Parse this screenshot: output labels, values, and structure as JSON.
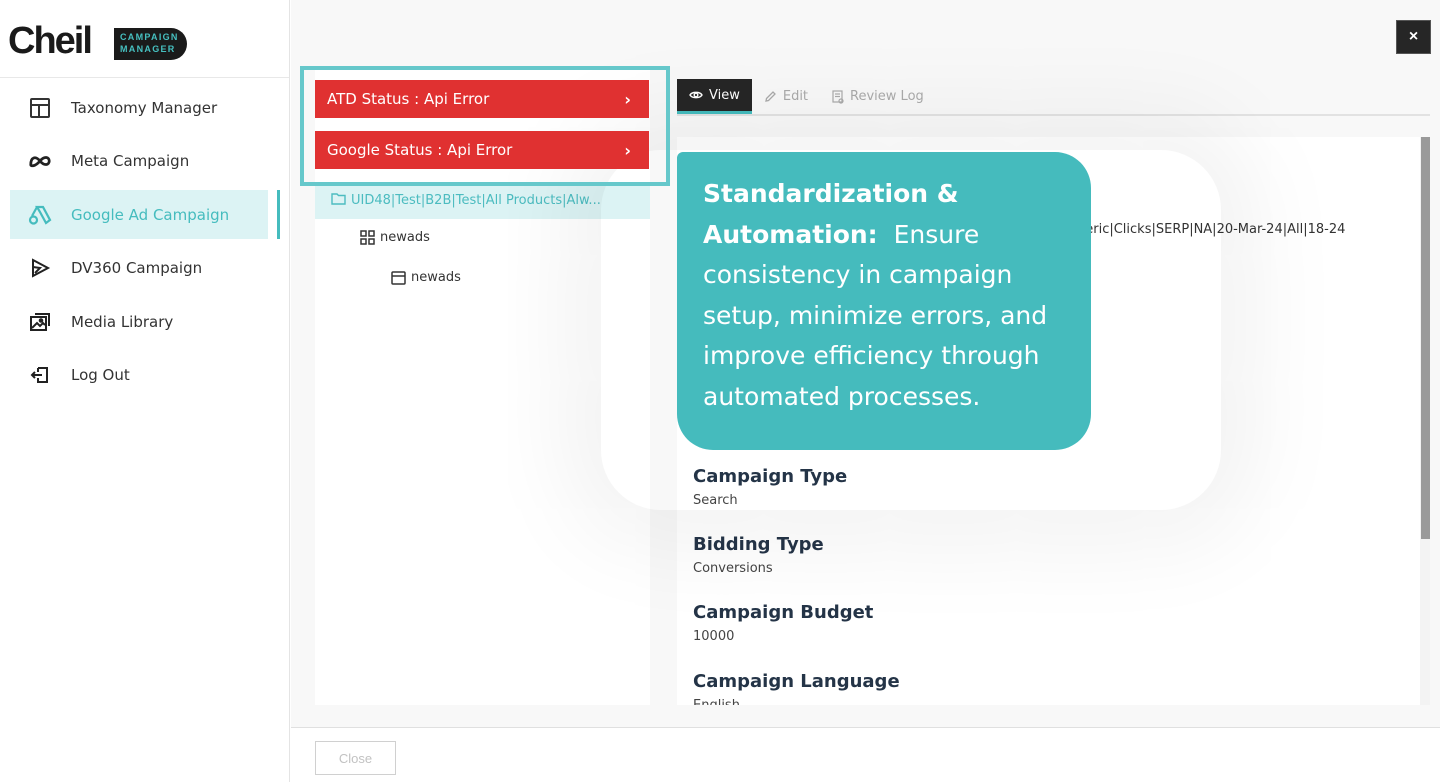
{
  "brand": {
    "name": "Cheil",
    "badge_line1": "CAMPAIGN",
    "badge_line2": "MANAGER"
  },
  "sidebar": {
    "items": [
      {
        "label": "Taxonomy Manager",
        "icon": "layout-icon",
        "active": false
      },
      {
        "label": "Meta Campaign",
        "icon": "meta-icon",
        "active": false
      },
      {
        "label": "Google Ad Campaign",
        "icon": "google-ads-icon",
        "active": true
      },
      {
        "label": "DV360 Campaign",
        "icon": "dv360-icon",
        "active": false
      },
      {
        "label": "Media Library",
        "icon": "media-library-icon",
        "active": false
      },
      {
        "label": "Log Out",
        "icon": "logout-icon",
        "active": false
      }
    ]
  },
  "modal": {
    "close_icon": "×",
    "status": {
      "atd": "ATD Status : Api Error",
      "google": "Google Status : Api Error",
      "chevron": "›",
      "color": "#e03131"
    },
    "tree": {
      "root": "UID48|Test|B2B|Test|All Products|Alw...",
      "ad_group": "newads",
      "ad": "newads"
    },
    "tabs": [
      {
        "label": "View",
        "active": true
      },
      {
        "label": "Edit",
        "active": false
      },
      {
        "label": "Review Log",
        "active": false
      }
    ],
    "detail": {
      "campaign_name_tail": "neric|Clicks|SERP|NA|20-Mar-24|All|18-24",
      "fields": [
        {
          "label": "Campaign Type",
          "value": "Search"
        },
        {
          "label": "Bidding Type",
          "value": "Conversions"
        },
        {
          "label": "Campaign Budget",
          "value": "10000"
        },
        {
          "label": "Campaign Language",
          "value": "English"
        }
      ]
    },
    "footer": {
      "close_label": "Close"
    }
  },
  "callout": {
    "title_bold": "Standardization & Automation:",
    "body": "Ensure consistency in campaign setup, minimize errors, and improve efficiency through automated processes.",
    "color": "#45bbbd"
  },
  "colors": {
    "accent": "#45bcbe",
    "active_bg": "#dcf3f4",
    "dark": "#262626"
  }
}
